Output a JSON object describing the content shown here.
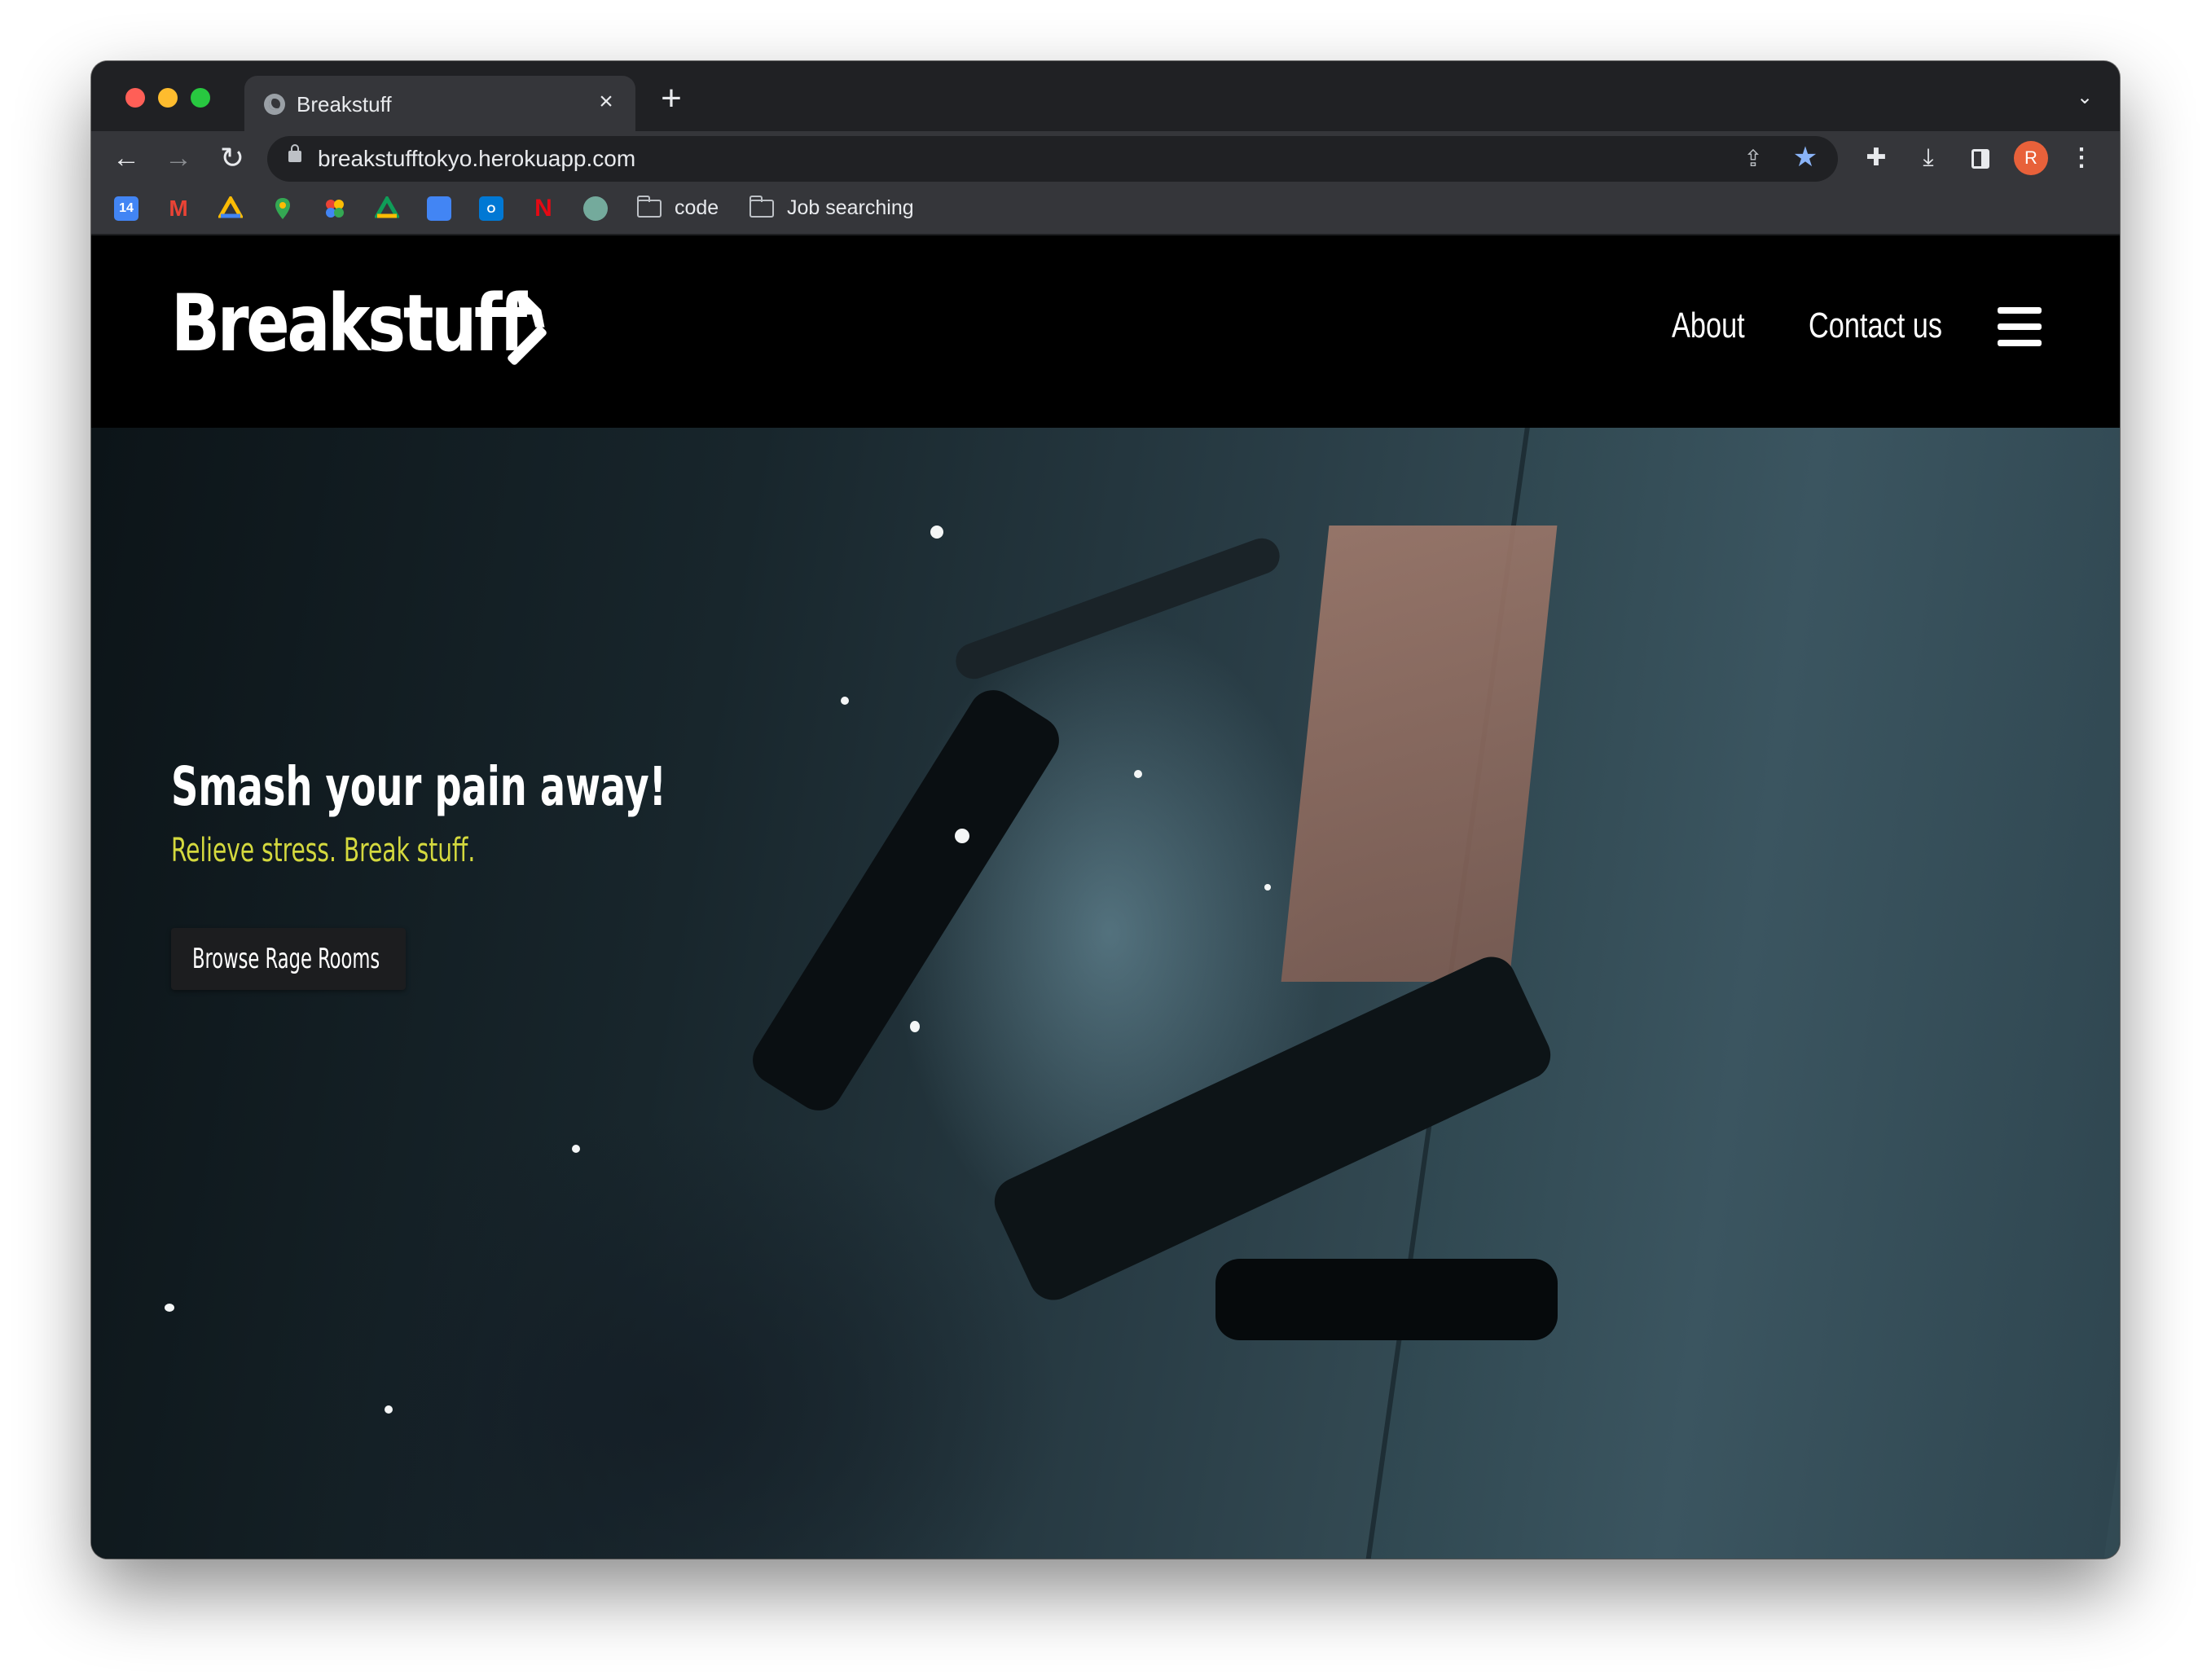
{
  "browser": {
    "tab": {
      "title": "Breakstuff",
      "close": "×"
    },
    "new_tab": "+",
    "url": "breakstufftokyo.herokuapp.com",
    "avatar_initial": "R",
    "bookmarks": [
      {
        "icon": "google-calendar-icon",
        "color": "#4285f4",
        "label": "14"
      },
      {
        "icon": "gmail-icon",
        "color": "#ea4335",
        "label": "M"
      },
      {
        "icon": "google-drive-icon",
        "color": "#fbbc04"
      },
      {
        "icon": "google-maps-icon",
        "color": "#34a853"
      },
      {
        "icon": "google-photos-icon",
        "color": "#ea4335"
      },
      {
        "icon": "google-drive-icon",
        "color": "#0f9d58"
      },
      {
        "icon": "google-translate-icon",
        "color": "#4285f4"
      },
      {
        "icon": "outlook-icon",
        "color": "#0078d4"
      },
      {
        "icon": "netflix-icon",
        "color": "#e50914",
        "label": "N"
      },
      {
        "icon": "chatgpt-icon",
        "color": "#74aa9c"
      }
    ],
    "bookmark_folders": [
      "code",
      "Job searching"
    ]
  },
  "site": {
    "logo": "Breakstuff",
    "nav": {
      "about": "About",
      "contact": "Contact us"
    },
    "hero": {
      "title": "Smash your pain away!",
      "subtitle": "Relieve stress. Break stuff.",
      "cta": "Browse Rage Rooms"
    },
    "colors": {
      "accent": "#d4d93e",
      "background": "#000000"
    }
  }
}
